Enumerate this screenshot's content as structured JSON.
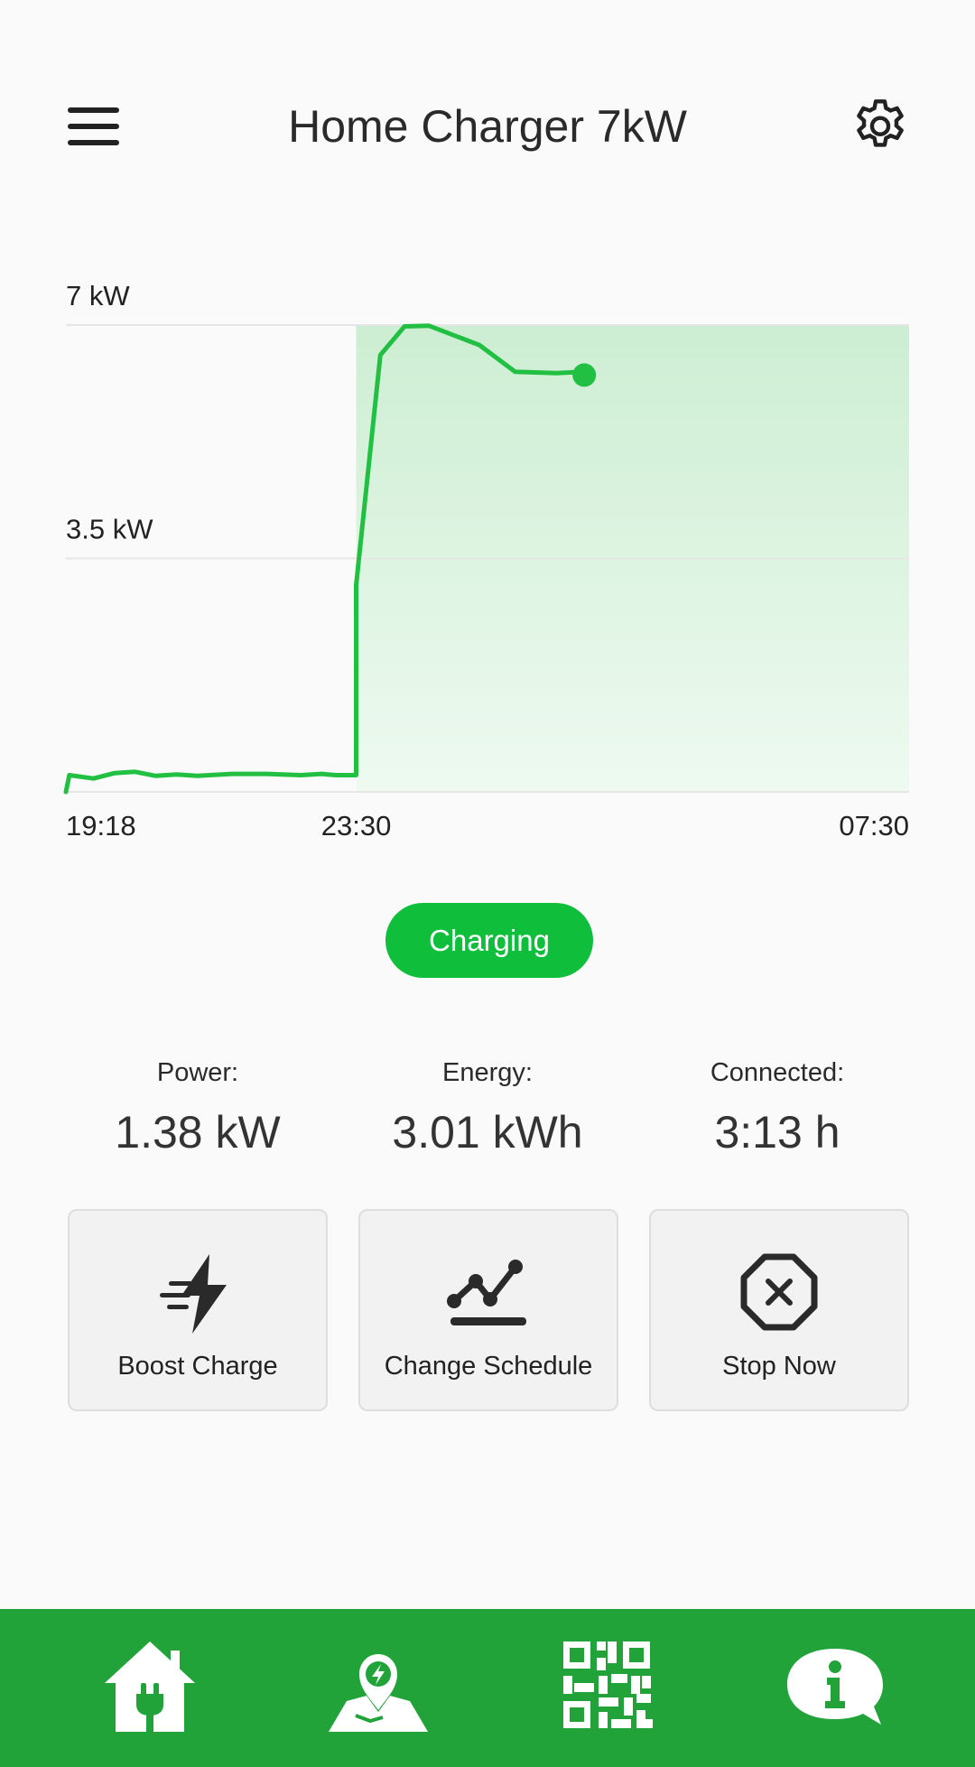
{
  "header": {
    "title": "Home Charger 7kW",
    "menu_icon": "hamburger-menu-icon",
    "settings_icon": "gear-icon"
  },
  "chart_data": {
    "type": "area",
    "y_ticks": [
      "7 kW",
      "3.5 kW"
    ],
    "x_ticks": [
      "19:18",
      "23:30",
      "07:30"
    ],
    "ylim": [
      0,
      7
    ],
    "x_domain": [
      "19:18",
      "07:30"
    ],
    "series": [
      {
        "points": [
          [
            "19:18",
            0.0
          ],
          [
            "19:21",
            0.25
          ],
          [
            "19:42",
            0.2
          ],
          [
            "20:00",
            0.28
          ],
          [
            "20:18",
            0.3
          ],
          [
            "20:36",
            0.24
          ],
          [
            "20:54",
            0.26
          ],
          [
            "21:12",
            0.24
          ],
          [
            "21:42",
            0.27
          ],
          [
            "22:12",
            0.27
          ],
          [
            "22:42",
            0.25
          ],
          [
            "23:00",
            0.27
          ],
          [
            "23:12",
            0.25
          ],
          [
            "23:30",
            0.25
          ],
          [
            "23:30",
            3.1
          ],
          [
            "23:51",
            6.55
          ],
          [
            "24:12",
            6.98
          ],
          [
            "24:33",
            6.99
          ],
          [
            "25:17",
            6.7
          ],
          [
            "25:48",
            6.3
          ],
          [
            "26:24",
            6.28
          ],
          [
            "26:48",
            6.3
          ]
        ],
        "color": "#21c043"
      }
    ],
    "highlight_region": {
      "start": "23:30",
      "end": "07:30",
      "color": "#d2f2d8"
    },
    "current_point": {
      "x": "26:48",
      "y": 6.25
    },
    "grid": true
  },
  "status": {
    "label": "Charging",
    "color": "#0fbf3c"
  },
  "stats": [
    {
      "label": "Power:",
      "value": "1.38 kW"
    },
    {
      "label": "Energy:",
      "value": "3.01 kWh"
    },
    {
      "label": "Connected:",
      "value": "3:13 h"
    }
  ],
  "actions": [
    {
      "label": "Boost Charge",
      "icon": "lightning-bolt-icon"
    },
    {
      "label": "Change Schedule",
      "icon": "schedule-graph-icon"
    },
    {
      "label": "Stop Now",
      "icon": "stop-octagon-icon"
    }
  ],
  "bottom_nav": {
    "color": "#21a33a",
    "items": [
      {
        "icon": "home-plug-icon"
      },
      {
        "icon": "map-pin-lightning-icon"
      },
      {
        "icon": "qr-code-icon"
      },
      {
        "icon": "info-chat-icon"
      }
    ]
  }
}
